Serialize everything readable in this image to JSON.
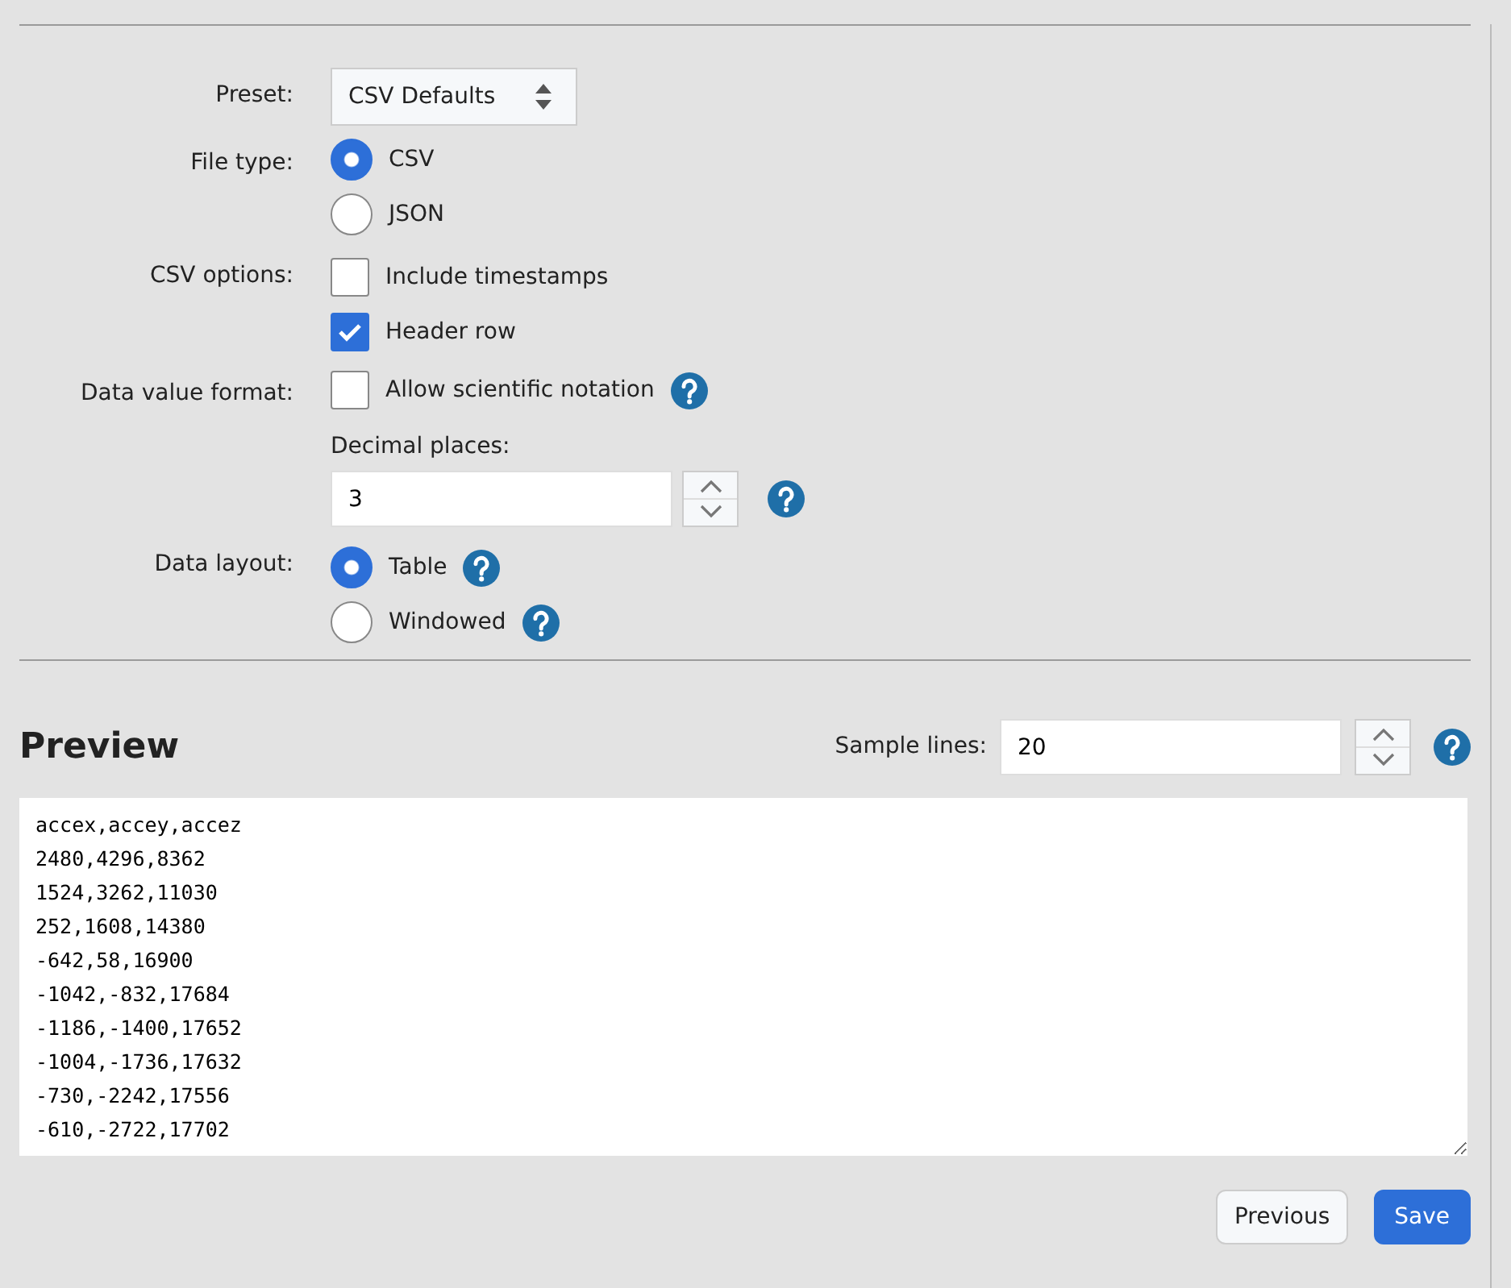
{
  "preset": {
    "label": "Preset:",
    "value": "CSV Defaults"
  },
  "file_type": {
    "label": "File type:",
    "options": [
      {
        "label": "CSV",
        "selected": true,
        "help": false
      },
      {
        "label": "JSON",
        "selected": false,
        "help": false
      }
    ]
  },
  "csv_options": {
    "label": "CSV options:",
    "options": [
      {
        "label": "Include timestamps",
        "checked": false,
        "help": false
      },
      {
        "label": "Header row",
        "checked": true,
        "help": false
      }
    ]
  },
  "data_value_format": {
    "label": "Data value format:",
    "options": [
      {
        "label": "Allow scientific notation",
        "checked": false,
        "help": true
      }
    ],
    "decimal_places": {
      "label": "Decimal places:",
      "value": "3",
      "help": true
    }
  },
  "data_layout": {
    "label": "Data layout:",
    "options": [
      {
        "label": "Table",
        "selected": true,
        "help": true
      },
      {
        "label": "Windowed",
        "selected": false,
        "help": true
      }
    ]
  },
  "preview": {
    "title": "Preview",
    "sample_lines": {
      "label": "Sample lines:",
      "value": "20",
      "help": true
    },
    "lines": [
      "accex,accey,accez",
      "2480,4296,8362",
      "1524,3262,11030",
      "252,1608,14380",
      "-642,58,16900",
      "-1042,-832,17684",
      "-1186,-1400,17652",
      "-1004,-1736,17632",
      "-730,-2242,17556",
      "-610,-2722,17702"
    ]
  },
  "buttons": [
    {
      "label": "Previous",
      "kind": "secondary"
    },
    {
      "label": "Save",
      "kind": "primary"
    }
  ]
}
